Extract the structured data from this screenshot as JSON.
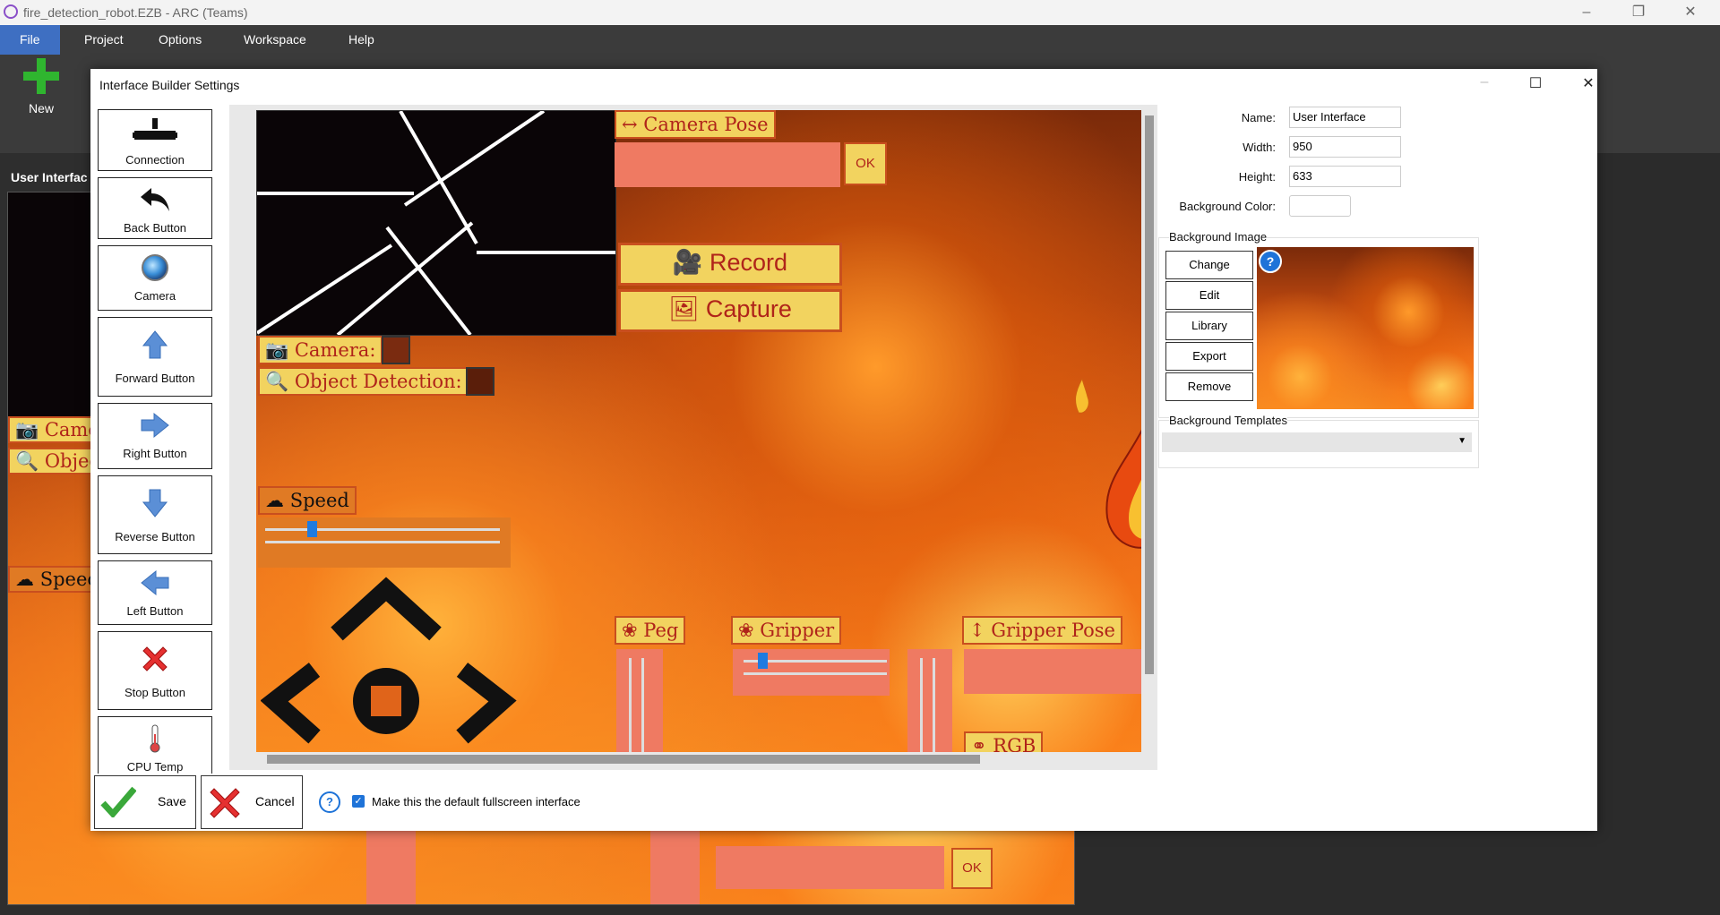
{
  "app": {
    "title": "fire_detection_robot.EZB - ARC (Teams)",
    "menu": [
      "File",
      "Project",
      "Options",
      "Workspace",
      "Help"
    ],
    "toolbar_new": "New",
    "panel_title": "User Interfac",
    "bg_labels": {
      "camera": "Came",
      "object": "Objec",
      "speed": "Speec",
      "ok": "OK"
    }
  },
  "dialog": {
    "title": "Interface Builder Settings",
    "palette": [
      "Connection",
      "Back Button",
      "Camera",
      "Forward Button",
      "Right Button",
      "Reverse Button",
      "Left Button",
      "Stop Button",
      "CPU Temp"
    ],
    "canvas": {
      "camera_pose": "↔ Camera Pose",
      "ok": "OK",
      "record": "Record",
      "capture": "Capture",
      "camera": "Camera:",
      "object_detection": "Object Detection:",
      "speed": "Speed",
      "peg": "Peg",
      "gripper": "Gripper",
      "gripper_pose": "↕ Gripper Pose",
      "rgb": "RGB"
    },
    "props": {
      "name_label": "Name:",
      "name_value": "User Interface",
      "width_label": "Width:",
      "width_value": "950",
      "height_label": "Height:",
      "height_value": "633",
      "bgcolor_label": "Background Color:"
    },
    "bg_image": {
      "title": "Background Image",
      "buttons": [
        "Change",
        "Edit",
        "Library",
        "Export",
        "Remove"
      ]
    },
    "bg_templates": {
      "title": "Background Templates"
    },
    "footer": {
      "save": "Save",
      "cancel": "Cancel",
      "default_label": "Make this the default fullscreen interface",
      "default_checked": true
    }
  }
}
